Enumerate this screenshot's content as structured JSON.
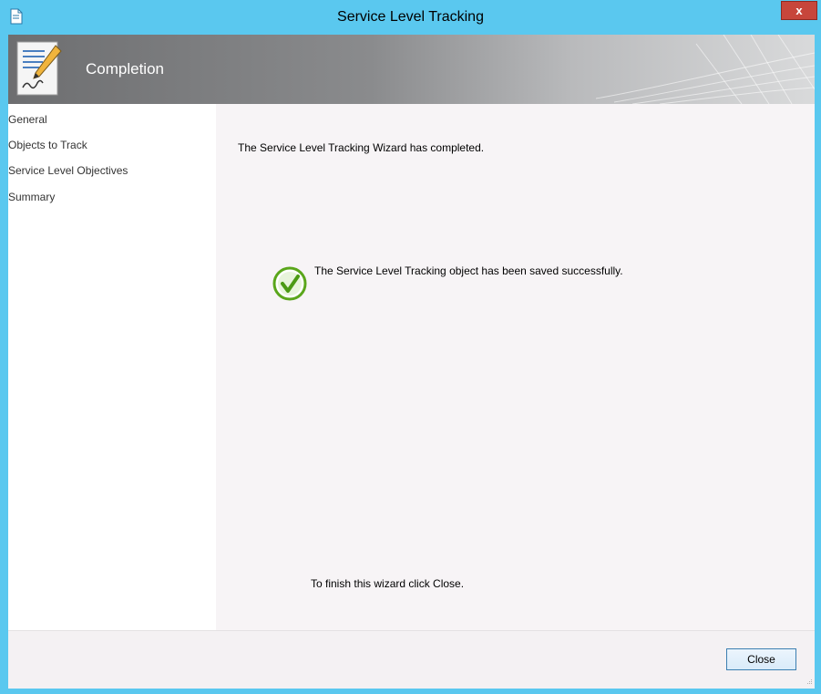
{
  "window": {
    "title": "Service Level Tracking",
    "close_glyph": "x"
  },
  "header": {
    "title": "Completion",
    "icon": "wizard-document-pencil-icon"
  },
  "nav": {
    "items": [
      {
        "label": "General"
      },
      {
        "label": "Objects to Track"
      },
      {
        "label": "Service Level Objectives"
      },
      {
        "label": "Summary"
      }
    ]
  },
  "content": {
    "completed_text": "The Service Level Tracking Wizard has completed.",
    "status_icon": "check-circle-icon",
    "status_text": "The Service Level Tracking object has been saved successfully.",
    "finish_text": "To finish this wizard click Close."
  },
  "footer": {
    "close_label": "Close"
  },
  "colors": {
    "titlebar": "#5ac8ef",
    "close_button": "#c7463b",
    "success": "#5aa61b"
  }
}
